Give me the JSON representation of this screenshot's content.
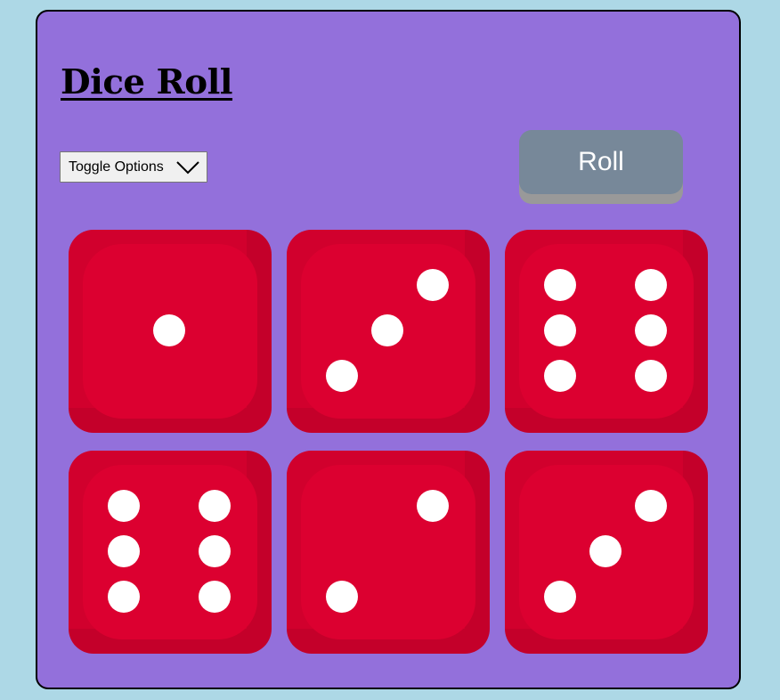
{
  "app": {
    "title": "Dice Roll"
  },
  "controls": {
    "toggle_label": "Toggle Options",
    "roll_label": "Roll"
  },
  "dice": [
    {
      "value": 1
    },
    {
      "value": 3
    },
    {
      "value": 6
    },
    {
      "value": 6
    },
    {
      "value": 2
    },
    {
      "value": 3
    }
  ],
  "colors": {
    "page_background": "#add8e6",
    "card_background": "#9370db",
    "die_face": "#dc0030",
    "die_shade": "#c4002a",
    "pip": "#ffffff",
    "roll_button": "#778899",
    "roll_button_shadow": "#999999"
  }
}
